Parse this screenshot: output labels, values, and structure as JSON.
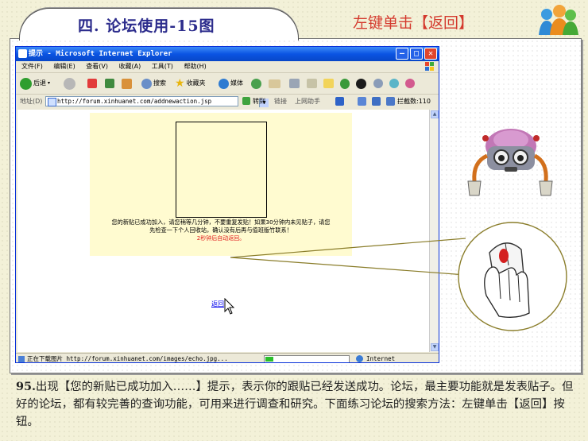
{
  "slide": {
    "title": "四. 论坛使用-15图",
    "instruction": "左键单击【返回】"
  },
  "browser": {
    "window_title": "提示 - Microsoft Internet Explorer",
    "menu": [
      "文件(F)",
      "编辑(E)",
      "查看(V)",
      "收藏(A)",
      "工具(T)",
      "帮助(H)"
    ],
    "toolbar": {
      "back": "后退",
      "search": "搜索",
      "favorites": "收藏夹",
      "media": "媒体"
    },
    "address": {
      "label": "地址(D)",
      "url": "http://forum.xinhuanet.com/addnewaction.jsp",
      "go": "转到",
      "links": "链接",
      "online_assistant": "上网助手",
      "extra": "拦截数:110"
    },
    "status": {
      "text": "正在下载图片 http://forum.xinhuanet.com/images/echo.jpg...",
      "zone": "Internet",
      "progress": 0.1
    }
  },
  "page": {
    "notice_line1": "您的新贴已成功加入，请您稍等几分钟，不要重复发贴！如果30分钟内未见贴子，请您",
    "notice_line2": "先检查一下个人回收站，确认没有后再与值班版竹联系！",
    "countdown": "2秒钟后自动返回。",
    "back_link": "返回"
  },
  "caption": {
    "number": "95.",
    "text": "出现【您的新贴已成功加入……】提示，表示你的跟贴已经发送成功。论坛，最主要功能就是发表贴子。但好的论坛，都有较完善的查询功能，可用来进行调查和研究。下面练习论坛的搜索方法：左键单击【返回】按钮。"
  },
  "colors": {
    "accent_red": "#d43a2e",
    "title_blue": "#2c2c8c",
    "notice_bg": "#fffbd0",
    "link": "#0000ee",
    "countdown_red": "#e01b1b"
  }
}
